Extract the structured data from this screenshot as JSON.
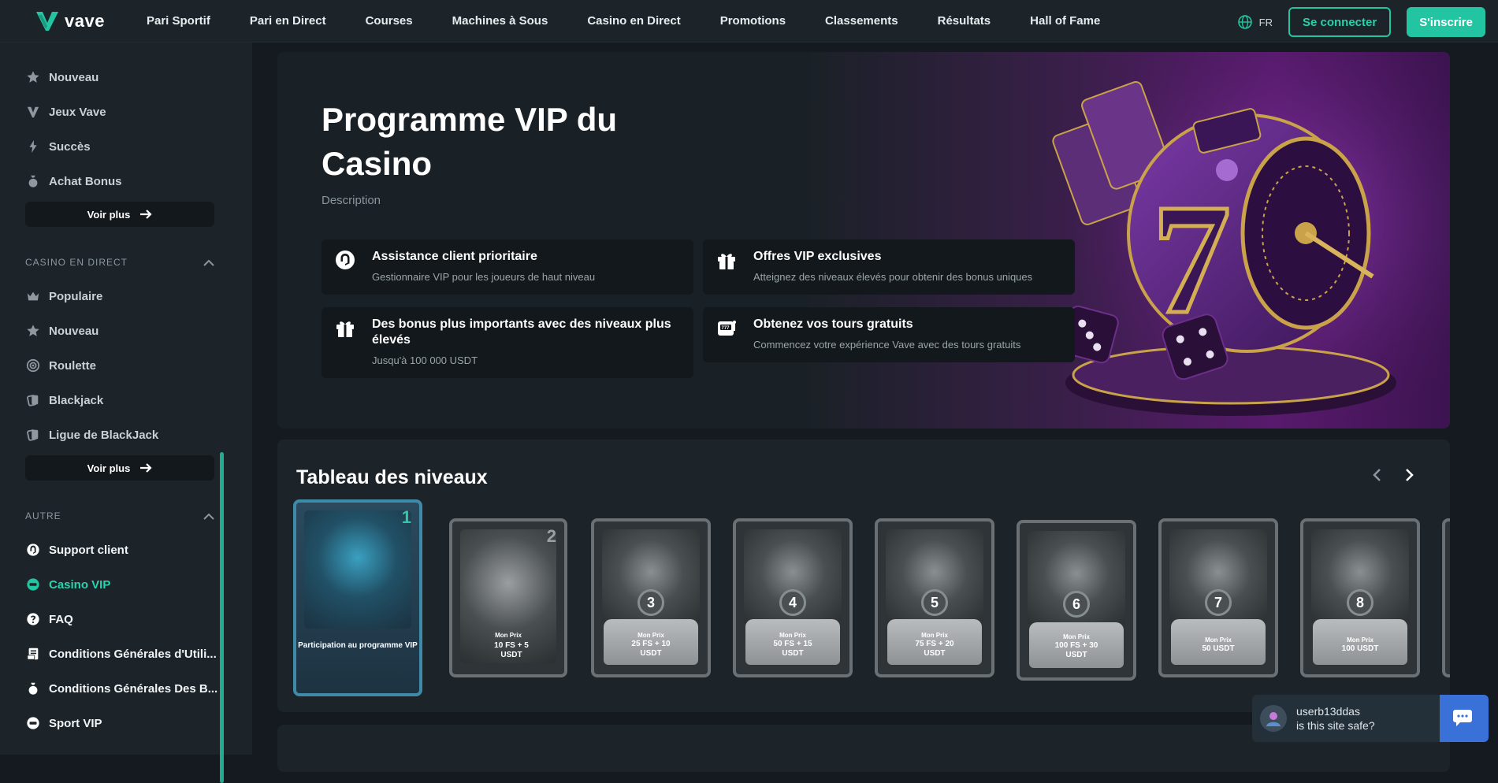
{
  "brand": {
    "name": "vave",
    "accent": "#23c4a1"
  },
  "nav": [
    "Pari Sportif",
    "Pari en Direct",
    "Courses",
    "Machines à Sous",
    "Casino en Direct",
    "Promotions",
    "Classements",
    "Résultats",
    "Hall of Fame"
  ],
  "header": {
    "language": "FR",
    "login": "Se connecter",
    "signup": "S'inscrire"
  },
  "sidebar": {
    "top_items": [
      {
        "label": "Nouveau",
        "icon": "star-icon"
      },
      {
        "label": "Jeux Vave",
        "icon": "vave-icon"
      },
      {
        "label": "Succès",
        "icon": "bolt-icon"
      },
      {
        "label": "Achat Bonus",
        "icon": "money-bag-icon"
      }
    ],
    "more1": "Voir plus",
    "live_title": "CASINO EN DIRECT",
    "live_items": [
      {
        "label": "Populaire",
        "icon": "crown-icon"
      },
      {
        "label": "Nouveau",
        "icon": "star-icon"
      },
      {
        "label": "Roulette",
        "icon": "roulette-icon"
      },
      {
        "label": "Blackjack",
        "icon": "cards-icon"
      },
      {
        "label": "Ligue de BlackJack",
        "icon": "cards-icon"
      }
    ],
    "more2": "Voir plus",
    "other_title": "AUTRE",
    "other_items": [
      {
        "label": "Support client",
        "icon": "support-icon"
      },
      {
        "label": "Casino VIP",
        "icon": "vip-icon"
      },
      {
        "label": "FAQ",
        "icon": "question-icon"
      },
      {
        "label": "Conditions Générales d'Utili...",
        "icon": "document-icon"
      },
      {
        "label": "Conditions Générales Des B...",
        "icon": "money-bag-icon"
      },
      {
        "label": "Sport VIP",
        "icon": "vip-icon"
      }
    ]
  },
  "hero": {
    "title": "Programme VIP du Casino",
    "description": "Description",
    "features": [
      {
        "title": "Assistance client prioritaire",
        "desc": "Gestionnaire VIP pour les joueurs de haut niveau",
        "icon": "support-icon"
      },
      {
        "title": "Offres VIP exclusives",
        "desc": "Atteignez des niveaux élevés pour obtenir des bonus uniques",
        "icon": "gift-icon"
      },
      {
        "title": "Des bonus plus importants avec des niveaux plus élevés",
        "desc": "Jusqu'à 100 000 USDT",
        "icon": "gift-icon"
      },
      {
        "title": "Obtenez vos tours gratuits",
        "desc": "Commencez votre expérience Vave avec des tours gratuits",
        "icon": "slot-machine-icon"
      }
    ]
  },
  "levels": {
    "title": "Tableau des niveaux",
    "cards": [
      {
        "num": "1",
        "prize_label": "",
        "prize": "Participation au programme VIP"
      },
      {
        "num": "2",
        "prize_label": "Mon Prix",
        "prize": "10 FS + 5 USDT"
      },
      {
        "num": "3",
        "prize_label": "Mon Prix",
        "prize": "25 FS + 10 USDT"
      },
      {
        "num": "4",
        "prize_label": "Mon Prix",
        "prize": "50 FS + 15 USDT"
      },
      {
        "num": "5",
        "prize_label": "Mon Prix",
        "prize": "75 FS + 20 USDT"
      },
      {
        "num": "6",
        "prize_label": "Mon Prix",
        "prize": "100 FS + 30 USDT"
      },
      {
        "num": "7",
        "prize_label": "Mon Prix",
        "prize": "50 USDT"
      },
      {
        "num": "8",
        "prize_label": "Mon Prix",
        "prize": "100 USDT"
      }
    ]
  },
  "chat": {
    "user": "userb13ddas",
    "message": "is this site safe?"
  }
}
